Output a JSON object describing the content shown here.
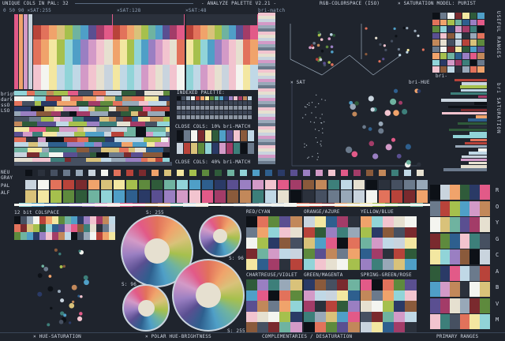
{
  "header": {
    "unique_cols": "UNIQUE COLS IN PAL: 32",
    "title": "- ANALYZE PALETTE V2.21 -",
    "rgb_colorspace": "RGB-COLORSPACE (ISO)",
    "sat_model": "× SATURATION MODEL: PURIST"
  },
  "hsv_labels": {
    "sat_list": "0 50 90 ×SAT:255",
    "sat128": "×SAT:128",
    "sat48": "×SAT:48",
    "bri_match": "bri-match"
  },
  "left_labels": [
    "bright",
    "dark",
    "ssO",
    "LSO"
  ],
  "left_labels2": [
    "NEU",
    "GRAY",
    "PAL",
    "ALF"
  ],
  "indexed": {
    "title": "INDEXED PALETTE:"
  },
  "close1": "CLOSE COLS: 10% bri-MATCH",
  "close2": "CLOSE COLS: 40% bri-MATCH",
  "sat_box": "× SAT",
  "bri_hue": "bri-HUE",
  "bri_label": "bri-",
  "useful_ranges": "USEFUL RANGES",
  "bri_saturation": "bri SATURATION",
  "colspace": "12 bit COLSPACE",
  "s255": "S: 255",
  "s96a": "S: 96",
  "s96b": "S: 96",
  "s255b": "S: 255",
  "compl_titles": [
    "RED/CYAN",
    "ORANGE/AZURE",
    "YELLOW/BLUE",
    "CHARTREUSE/VIOLET",
    "GREEN/MAGENTA",
    "SPRING-GREEN/ROSE"
  ],
  "letters": [
    "R",
    "O",
    "Y",
    "G",
    "C",
    "A",
    "B",
    "V",
    "M"
  ],
  "footer": {
    "hue_sat": "× HUE-SATURATION",
    "polar": "× POLAR HUE-BRIGHTNESS",
    "compl": "COMPLEMENTARIES / DESATURATION",
    "primary": "PRIMARY RANGES"
  },
  "palette": [
    "#0d1117",
    "#2b313c",
    "#465061",
    "#6b7a8c",
    "#98a8b8",
    "#c9d4de",
    "#f4f5f0",
    "#e2725b",
    "#b8433a",
    "#7a2a2e",
    "#f0a36b",
    "#d9c27a",
    "#f3e7a1",
    "#a6c04d",
    "#5e8a3d",
    "#2f5b3a",
    "#6fb3a0",
    "#91d4d8",
    "#4f9fc7",
    "#2e5f8e",
    "#2a3a66",
    "#5a4f91",
    "#9a7fc2",
    "#d39ac7",
    "#f2c4cf",
    "#e25a88",
    "#a33c68",
    "#8a5a3b",
    "#c2885a",
    "#3d7f7a",
    "#c0d8e6",
    "#e6e0d0"
  ]
}
